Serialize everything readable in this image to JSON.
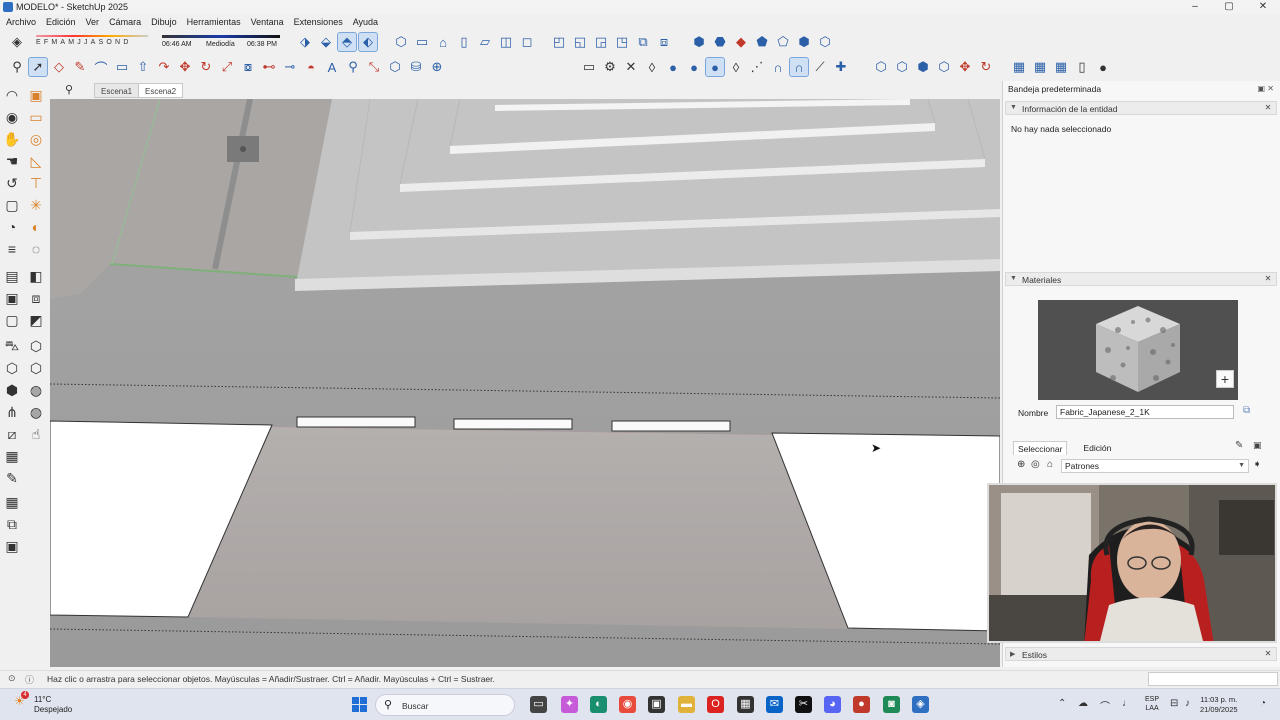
{
  "window": {
    "title": "MODELO* - SketchUp 2025",
    "controls": [
      "–",
      "▢",
      "✕"
    ]
  },
  "menu": [
    "Archivo",
    "Edición",
    "Ver",
    "Cámara",
    "Dibujo",
    "Herramientas",
    "Ventana",
    "Extensiones",
    "Ayuda"
  ],
  "shadows": {
    "months": "EFMAMJJASOND",
    "time_start": "06:46 AM",
    "time_mid": "Mediodía",
    "time_end": "06:38 PM"
  },
  "scenes": {
    "tabs": [
      "Escena1",
      "Escena2"
    ],
    "active": "Escena2"
  },
  "tray": {
    "title": "Bandeja predeterminada",
    "entity_panel": {
      "title": "Información de la entidad",
      "content": "No hay nada seleccionado"
    },
    "materials_panel": {
      "title": "Materiales",
      "name_label": "Nombre",
      "name_value": "Fabric_Japanese_2_1K",
      "tab_select": "Seleccionar",
      "tab_edit": "Edición",
      "collection": "Patrones"
    },
    "styles_panel": {
      "title": "Estilos"
    }
  },
  "status": {
    "hint": "Haz clic o arrastra para seleccionar objetos. Mayúsculas = Añadir/Sustraer. Ctrl = Añadir. Mayúsculas + Ctrl = Sustraer."
  },
  "taskbar": {
    "weather_temp": "11°C",
    "weather_cond": "Despejado",
    "weather_badge": "4",
    "search_placeholder": "Buscar",
    "lang_1": "ESP",
    "lang_2": "LAA",
    "time": "11:03 p. m.",
    "date": "21/09/2025"
  }
}
